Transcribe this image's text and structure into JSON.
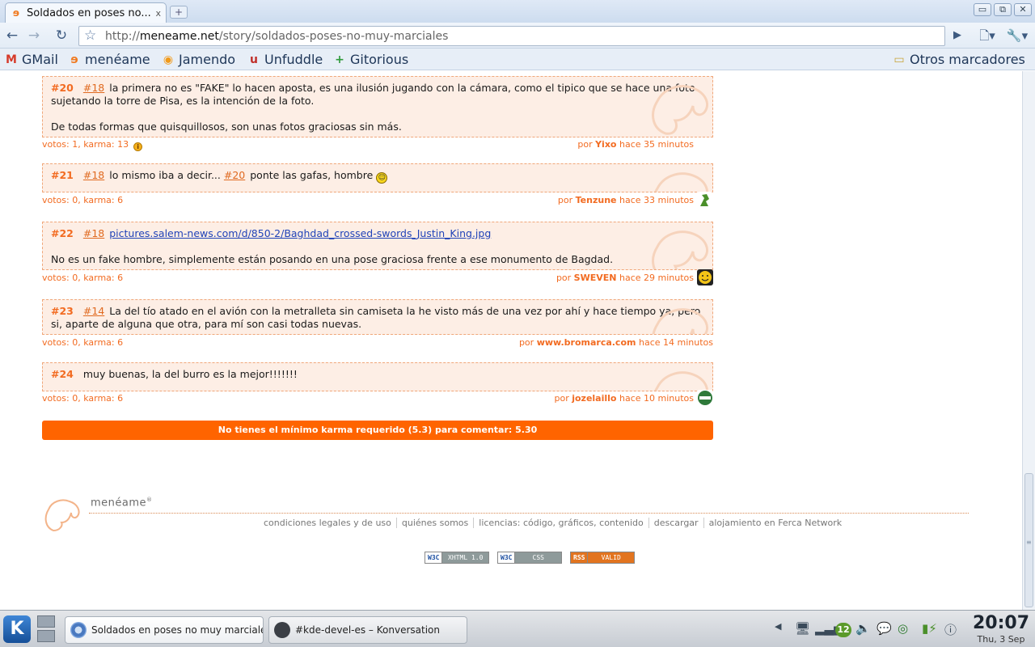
{
  "browser": {
    "tab_title": "Soldados en poses no...",
    "tab_close": "x",
    "new_tab": "+",
    "url_prefix": "http://",
    "url_host": "meneame.net",
    "url_path": "/story/soldados-poses-no-muy-marciales",
    "window_controls": {
      "minimize": "▭",
      "maximize": "⧉",
      "close": "✕"
    }
  },
  "bookmarks": [
    {
      "label": "GMail",
      "icon": "gmail-icon",
      "glyph": "M",
      "color": "#d63a2a"
    },
    {
      "label": "menéame",
      "icon": "meneame-icon",
      "glyph": "ɘ",
      "color": "#f07a20"
    },
    {
      "label": "Jamendo",
      "icon": "jamendo-icon",
      "glyph": "◉",
      "color": "#f19a1a"
    },
    {
      "label": "Unfuddle",
      "icon": "unfuddle-icon",
      "glyph": "u",
      "color": "#c0302a"
    },
    {
      "label": "Gitorious",
      "icon": "gitorious-icon",
      "glyph": "+",
      "color": "#2e9a3a"
    }
  ],
  "other_bookmarks": "Otros marcadores",
  "comments": [
    {
      "num": "#20",
      "ref": "#18",
      "text": "la primera no es \"FAKE\" lo hacen aposta, es una ilusión jugando con la cámara, como el tipico que se hace una foto sujetando la torre de Pisa, es la intención de la foto.",
      "text2": "De todas formas que quisquillosos, son unas fotos graciosas sin más.",
      "votes": "votos: 1, karma: 13",
      "author_prefix": "por ",
      "author": "Yixo",
      "time": " hace 35 minutos"
    },
    {
      "num": "#21",
      "ref": "#18",
      "text": "lo mismo iba a decir...",
      "ref2": "#20",
      "text_after": "ponte las gafas, hombre",
      "votes": "votos: 0, karma: 6",
      "author_prefix": "por ",
      "author": "Tenzune",
      "time": " hace 33 minutos"
    },
    {
      "num": "#22",
      "ref": "#18",
      "link": "pictures.salem-news.com/d/850-2/Baghdad_crossed-swords_Justin_King.jpg",
      "text2": "No es un fake hombre, simplemente están posando en una pose graciosa frente a ese monumento de Bagdad.",
      "votes": "votos: 0, karma: 6",
      "author_prefix": "por ",
      "author": "SWEVEN",
      "time": " hace 29 minutos"
    },
    {
      "num": "#23",
      "ref": "#14",
      "text": "La del tío atado en el avión con la metralleta sin camiseta la he visto más de una vez por ahí y hace tiempo ya, pero si, aparte de alguna que otra, para mí son casi todas nuevas.",
      "votes": "votos: 0, karma: 6",
      "author_prefix": "por ",
      "author": "www.bromarca.com",
      "time": " hace 14 minutos"
    },
    {
      "num": "#24",
      "text": "muy buenas, la del burro es la mejor!!!!!!!",
      "votes": "votos: 0, karma: 6",
      "author_prefix": "por ",
      "author": "jozelaillo",
      "time": " hace 10 minutos"
    }
  ],
  "karma_notice": "No tienes el mínimo karma requerido (5.3) para comentar: 5.30",
  "footer": {
    "brand": "menéame",
    "links": [
      "condiciones legales y de uso",
      "quiénes somos",
      "licencias: código, gráficos, contenido",
      "descargar",
      "alojamiento en Ferca Network"
    ],
    "badges": [
      {
        "a": "W3C",
        "b": "XHTML 1.0",
        "color": "#8e9a9a"
      },
      {
        "a": "W3C",
        "b": "CSS",
        "color": "#8e9a9a"
      },
      {
        "a": "RSS",
        "b": "VALID",
        "color": "#e2741f"
      }
    ]
  },
  "taskbar": {
    "start": "K",
    "tasks": [
      {
        "label": "Soldados en poses no muy marciale",
        "icon": "chrome-icon"
      },
      {
        "label": "#kde-devel-es – Konversation",
        "icon": "konversation-icon"
      }
    ],
    "tray_count": "12",
    "time": "20:07",
    "date": "Thu, 3 Sep"
  }
}
